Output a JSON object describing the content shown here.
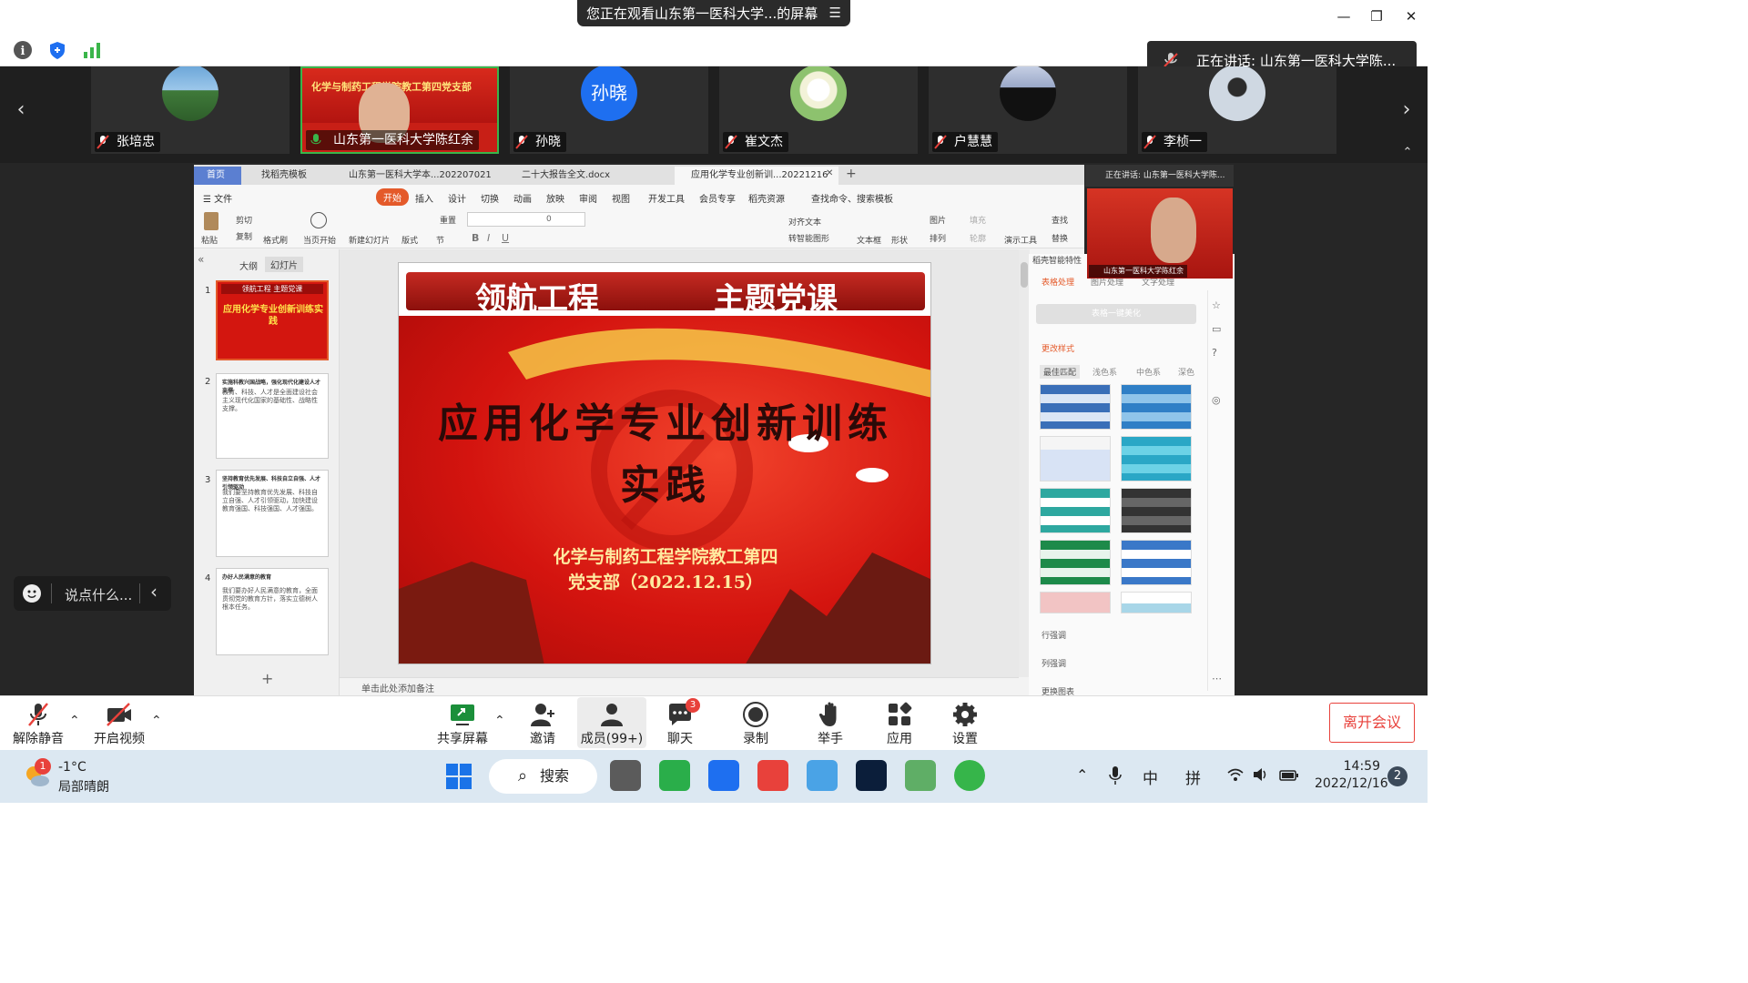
{
  "titlebar": {
    "screen_banner": "您正在观看山东第一医科大学...的屏幕",
    "menu_glyph": "☰",
    "minimize": "—",
    "restore": "❐",
    "close": "✕"
  },
  "speaking_banner": "正在讲话: 山东第一医科大学陈...",
  "participants": [
    {
      "name": "张培忠"
    },
    {
      "name": "山东第一医科大学陈红余",
      "active": true
    },
    {
      "name": "孙晓",
      "avatar_text": "孙晓"
    },
    {
      "name": "崔文杰"
    },
    {
      "name": "户慧慧"
    },
    {
      "name": "李桢一"
    }
  ],
  "wps": {
    "tabs": [
      "首页",
      "找稻壳模板",
      "山东第一医科大学本...202207021",
      "二十大报告全文.docx",
      "应用化学专业创新训...20221216"
    ],
    "menu": [
      "☰ 文件",
      "开始",
      "插入",
      "设计",
      "切换",
      "动画",
      "放映",
      "审阅",
      "视图",
      "开发工具",
      "会员专享",
      "稻壳资源",
      "查找命令、搜索模板"
    ],
    "ribbon": {
      "paste": "粘贴",
      "cut": "剪切",
      "copy": "复制",
      "format_painter": "格式刷",
      "from_current": "当页开始",
      "new_slide": "新建幻灯片",
      "layout": "版式",
      "section": "节",
      "reset": "重置",
      "font_size": "0",
      "align_text": "对齐文本",
      "smart_shape": "转智能图形",
      "textbox": "文本框",
      "shape": "形状",
      "picture": "图片",
      "arrange": "排列",
      "fill": "填充",
      "outline": "轮廓",
      "presenter": "演示工具",
      "find": "查找",
      "replace": "替换"
    },
    "view_tabs": [
      "大纲",
      "幻灯片"
    ],
    "thumbnails": [
      {
        "num": "1",
        "title": "领航工程    主题党课",
        "body": "应用化学专业创新训练实践"
      },
      {
        "num": "2",
        "title": "实施科教兴国战略，强化现代化建设人才支撑",
        "body": "教育、科技、人才是全面建设社会主义现代化国家的基础性、战略性支撑。"
      },
      {
        "num": "3",
        "title": "坚持教育优先发展、科技自立自强、人才引领驱动",
        "body": "我们要坚持教育优先发展、科技自立自强、人才引领驱动，加快建设教育强国、科技强国、人才强国。"
      },
      {
        "num": "4",
        "title": "办好人民满意的教育",
        "body": "我们要办好人民满意的教育，全面贯彻党的教育方针，落实立德树人根本任务。"
      }
    ],
    "slide": {
      "header_left": "领航工程",
      "header_right": "主题党课",
      "title_line1": "应用化学专业创新训练",
      "title_line2": "实践",
      "sub_line1": "化学与制药工程学院教工第四",
      "sub_line2": "党支部（2022.12.15）"
    },
    "notes_placeholder": "单击此处添加备注",
    "right_panel": {
      "header": "稻壳智能特性",
      "tabs": [
        "表格处理",
        "图片处理",
        "文字处理"
      ],
      "button": "表格一键美化",
      "section": "更改样式",
      "filters": [
        "最佳匹配",
        "浅色系",
        "中色系",
        "深色"
      ],
      "links": [
        "行强调",
        "列强调",
        "更换图表"
      ]
    }
  },
  "speaker": {
    "title": "正在讲话: 山东第一医科大学陈...",
    "name": "山东第一医科大学陈红余"
  },
  "chat": {
    "placeholder": "说点什么..."
  },
  "toolbar": {
    "unmute": "解除静音",
    "start_video": "开启视频",
    "share": "共享屏幕",
    "invite": "邀请",
    "members": "成员(99+)",
    "chat": "聊天",
    "chat_badge": "3",
    "record": "录制",
    "raise_hand": "举手",
    "apps": "应用",
    "settings": "设置",
    "leave": "离开会议"
  },
  "taskbar": {
    "weather_temp": "-1°C",
    "weather_desc": "局部晴朗",
    "weather_badge": "1",
    "search": "搜索",
    "ime_lang": "中",
    "ime_mode": "拼",
    "time": "14:59",
    "date": "2022/12/16",
    "notifications": "2"
  },
  "colors": {
    "accent_red": "#e8413b",
    "slide_red": "#d50f0f",
    "wps_orange": "#e45a2a",
    "avatar_blue": "#1e6ff0"
  }
}
